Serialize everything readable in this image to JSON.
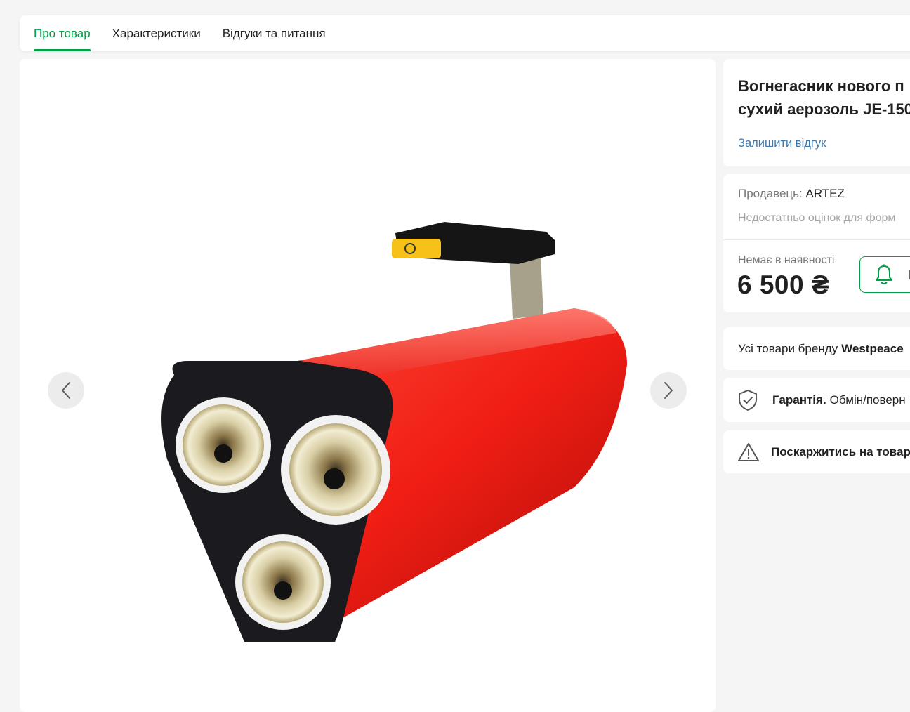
{
  "tabs": [
    {
      "label": "Про товар",
      "active": true
    },
    {
      "label": "Характеристики",
      "active": false
    },
    {
      "label": "Відгуки та питання",
      "active": false
    }
  ],
  "gallery": {
    "prev_icon": "chevron-left-icon",
    "next_icon": "chevron-right-icon",
    "image_subject": "red triple-nozzle aerosol fire extinguisher"
  },
  "product": {
    "title_line1": "Вогнегасник нового п",
    "title_line2": "сухий аерозоль JE-150",
    "review_link": "Залишити відгук"
  },
  "seller": {
    "label": "Продавець:",
    "name": "ARTEZ",
    "rating_note": "Недостатньо оцінок для форм",
    "stock_status": "Немає в наявності",
    "price": "6 500 ₴",
    "notify_icon": "bell-icon"
  },
  "brand": {
    "prefix": "Усі товари бренду",
    "name": "Westpeace"
  },
  "warranty": {
    "icon": "shield-check-icon",
    "label": "Гарантія.",
    "text": "Обмін/поверн"
  },
  "complain": {
    "icon": "warning-icon",
    "text": "Поскаржитись на товар"
  },
  "colors": {
    "accent": "#00a046",
    "link": "#3e77aa",
    "text": "#221f1f",
    "muted": "#797878"
  }
}
